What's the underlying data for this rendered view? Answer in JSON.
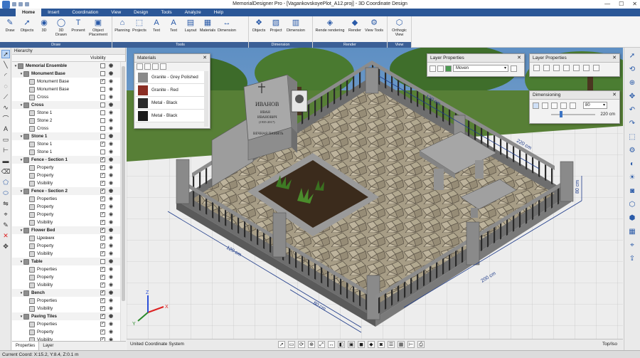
{
  "window": {
    "title": "MemorialDesigner Pro - [VagankovskoyePlot_A12.proj] - 3D Coordinate Design",
    "controls": [
      "—",
      "☐",
      "✕"
    ]
  },
  "menu": {
    "tabs": [
      "Home",
      "Insert",
      "Coordination",
      "View",
      "Design",
      "Tools",
      "Analyze",
      "Help"
    ],
    "active": "Home"
  },
  "ribbon": {
    "groups": [
      {
        "label": "Draw",
        "buttons": [
          "Draw",
          "Objects",
          "3D",
          "3D Drawn",
          "Pronent",
          "Object Placement"
        ]
      },
      {
        "label": "Tools",
        "buttons": [
          "Planning",
          "Projects",
          "Text",
          "Text",
          "Layout",
          "Materials",
          "Dimension"
        ]
      },
      {
        "label": "Dimension",
        "buttons": [
          "Objects",
          "Project",
          "Dimension"
        ]
      },
      {
        "label": "Render",
        "buttons": [
          "Rende rendering",
          "Render",
          "View Tools"
        ]
      },
      {
        "label": "View",
        "buttons": [
          "Orthogic View"
        ]
      }
    ]
  },
  "hierarchy": {
    "title": "Hierarchy",
    "col_visibility": "Visibility",
    "items": [
      {
        "label": "Memorial Ensemble",
        "level": 0,
        "group": true,
        "checked": false
      },
      {
        "label": "Monument Base",
        "level": 1,
        "group": true,
        "checked": false
      },
      {
        "label": "Monument Base",
        "level": 2,
        "group": false,
        "checked": true
      },
      {
        "label": "Monument Base",
        "level": 2,
        "group": false,
        "checked": false
      },
      {
        "label": "Cross",
        "level": 2,
        "group": false,
        "checked": false
      },
      {
        "label": "Cross",
        "level": 1,
        "group": true,
        "checked": false
      },
      {
        "label": "Stone 1",
        "level": 2,
        "group": false,
        "checked": false
      },
      {
        "label": "Stone 2",
        "level": 2,
        "group": false,
        "checked": false
      },
      {
        "label": "Cross",
        "level": 2,
        "group": false,
        "checked": false
      },
      {
        "label": "Stone 1",
        "level": 1,
        "group": true,
        "checked": false
      },
      {
        "label": "Stone 1",
        "level": 2,
        "group": false,
        "checked": true
      },
      {
        "label": "Stone 1",
        "level": 2,
        "group": false,
        "checked": false
      },
      {
        "label": "Fence - Section 1",
        "level": 1,
        "group": true,
        "checked": true
      },
      {
        "label": "Property",
        "level": 2,
        "group": false,
        "checked": true
      },
      {
        "label": "Property",
        "level": 2,
        "group": false,
        "checked": true
      },
      {
        "label": "Visibility",
        "level": 2,
        "group": false,
        "checked": true
      },
      {
        "label": "Fence - Section 2",
        "level": 1,
        "group": true,
        "checked": true
      },
      {
        "label": "Properties",
        "level": 2,
        "group": false,
        "checked": true
      },
      {
        "label": "Property",
        "level": 2,
        "group": false,
        "checked": true
      },
      {
        "label": "Property",
        "level": 2,
        "group": false,
        "checked": true
      },
      {
        "label": "Visibility",
        "level": 2,
        "group": false,
        "checked": true
      },
      {
        "label": "Flower Bed",
        "level": 1,
        "group": true,
        "checked": true
      },
      {
        "label": "Цревник",
        "level": 2,
        "group": false,
        "checked": true
      },
      {
        "label": "Property",
        "level": 2,
        "group": false,
        "checked": true
      },
      {
        "label": "Visibility",
        "level": 2,
        "group": false,
        "checked": true
      },
      {
        "label": "Table",
        "level": 1,
        "group": true,
        "checked": false
      },
      {
        "label": "Properties",
        "level": 2,
        "group": false,
        "checked": true
      },
      {
        "label": "Property",
        "level": 2,
        "group": false,
        "checked": true
      },
      {
        "label": "Visibility",
        "level": 2,
        "group": false,
        "checked": true
      },
      {
        "label": "Bench",
        "level": 1,
        "group": true,
        "checked": true
      },
      {
        "label": "Properties",
        "level": 2,
        "group": false,
        "checked": true
      },
      {
        "label": "Visibility",
        "level": 2,
        "group": false,
        "checked": true
      },
      {
        "label": "Paving Tiles",
        "level": 1,
        "group": true,
        "checked": true
      },
      {
        "label": "Properties",
        "level": 2,
        "group": false,
        "checked": true
      },
      {
        "label": "Property",
        "level": 2,
        "group": false,
        "checked": true
      },
      {
        "label": "Visibility",
        "level": 2,
        "group": false,
        "checked": true
      }
    ],
    "bottom_tabs": [
      "Properties",
      "Layer"
    ]
  },
  "materials_panel": {
    "title": "Materials",
    "items": [
      {
        "label": "Granite - Grey Polished",
        "color": "#8a8a8a"
      },
      {
        "label": "Granite - Red",
        "color": "#8b2e24"
      },
      {
        "label": "Metal - Black",
        "color": "#2a2a2a"
      },
      {
        "label": "Metal - Black",
        "color": "#1c1c1c"
      }
    ]
  },
  "layer_panel_1": {
    "title": "Layer Properties",
    "select_value": "Moven"
  },
  "layer_panel_2": {
    "title": "Layer Properties"
  },
  "dimensioning_panel": {
    "title": "Dimensioning",
    "select_value": "80",
    "slider_value": "220 cm",
    "slider_fraction": 0.2
  },
  "viewport": {
    "dimensions": [
      "120 cm",
      "220 cm",
      "80 cm",
      "120 cm",
      "200 cm",
      "80 cm"
    ],
    "monument_text": [
      "ИВАНОВ",
      "ИВАН",
      "ИВАНОВИЧ",
      "(1935-2017)",
      "ВЕЧНАЯ ПАМЯТЬ"
    ],
    "coordinate_system": "United Coordinate System",
    "view_name": "Top/Iso"
  },
  "axes": {
    "x": "X",
    "y": "Y",
    "z": "Z"
  },
  "status": {
    "coords": "Current Coord: X:15.2, Y:8.4, Z:0.1 m"
  },
  "colors": {
    "menu_bar": "#2b5797",
    "ribbon_label": "#3b5f96",
    "granite": "#9a9a9a",
    "grass": "#4d7a2c",
    "paving": "#a89e88"
  }
}
